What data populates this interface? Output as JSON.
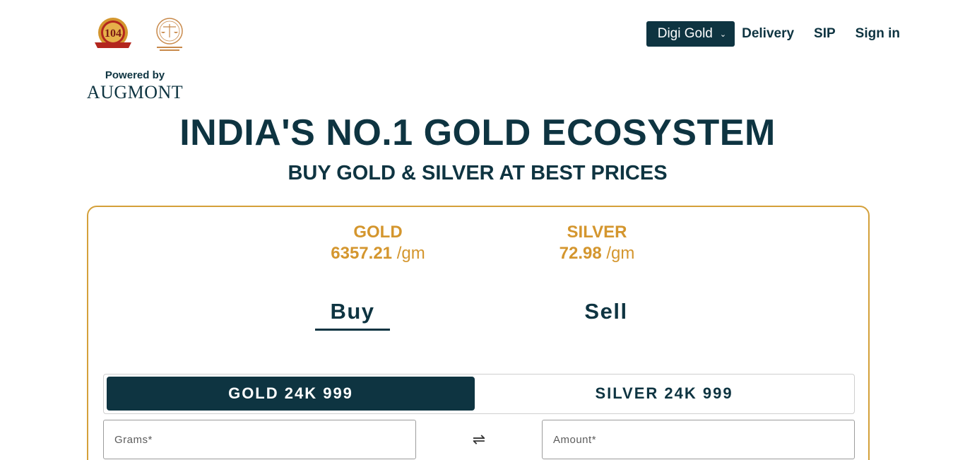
{
  "header": {
    "badge_text": "104",
    "powered_by": "Powered by",
    "augmont": "AUGMONT"
  },
  "nav": {
    "digi_gold": "Digi Gold",
    "delivery": "Delivery",
    "sip": "SIP",
    "sign_in": "Sign in"
  },
  "hero": {
    "title": "INDIA'S NO.1 GOLD ECOSYSTEM",
    "subtitle": "BUY GOLD & SILVER AT BEST PRICES"
  },
  "prices": {
    "gold": {
      "name": "GOLD",
      "value": "6357.21",
      "unit": "/gm"
    },
    "silver": {
      "name": "SILVER",
      "value": "72.98",
      "unit": "/gm"
    }
  },
  "tabs": {
    "buy": "Buy",
    "sell": "Sell",
    "active": "buy"
  },
  "metals": {
    "gold": "GOLD 24K 999",
    "silver": "SILVER 24K 999",
    "active": "gold"
  },
  "fields": {
    "grams_placeholder": "Grams*",
    "amount_placeholder": "Amount*"
  },
  "colors": {
    "navy": "#0e3441",
    "gold": "#d4962e",
    "border_gold": "#d4a03a"
  }
}
